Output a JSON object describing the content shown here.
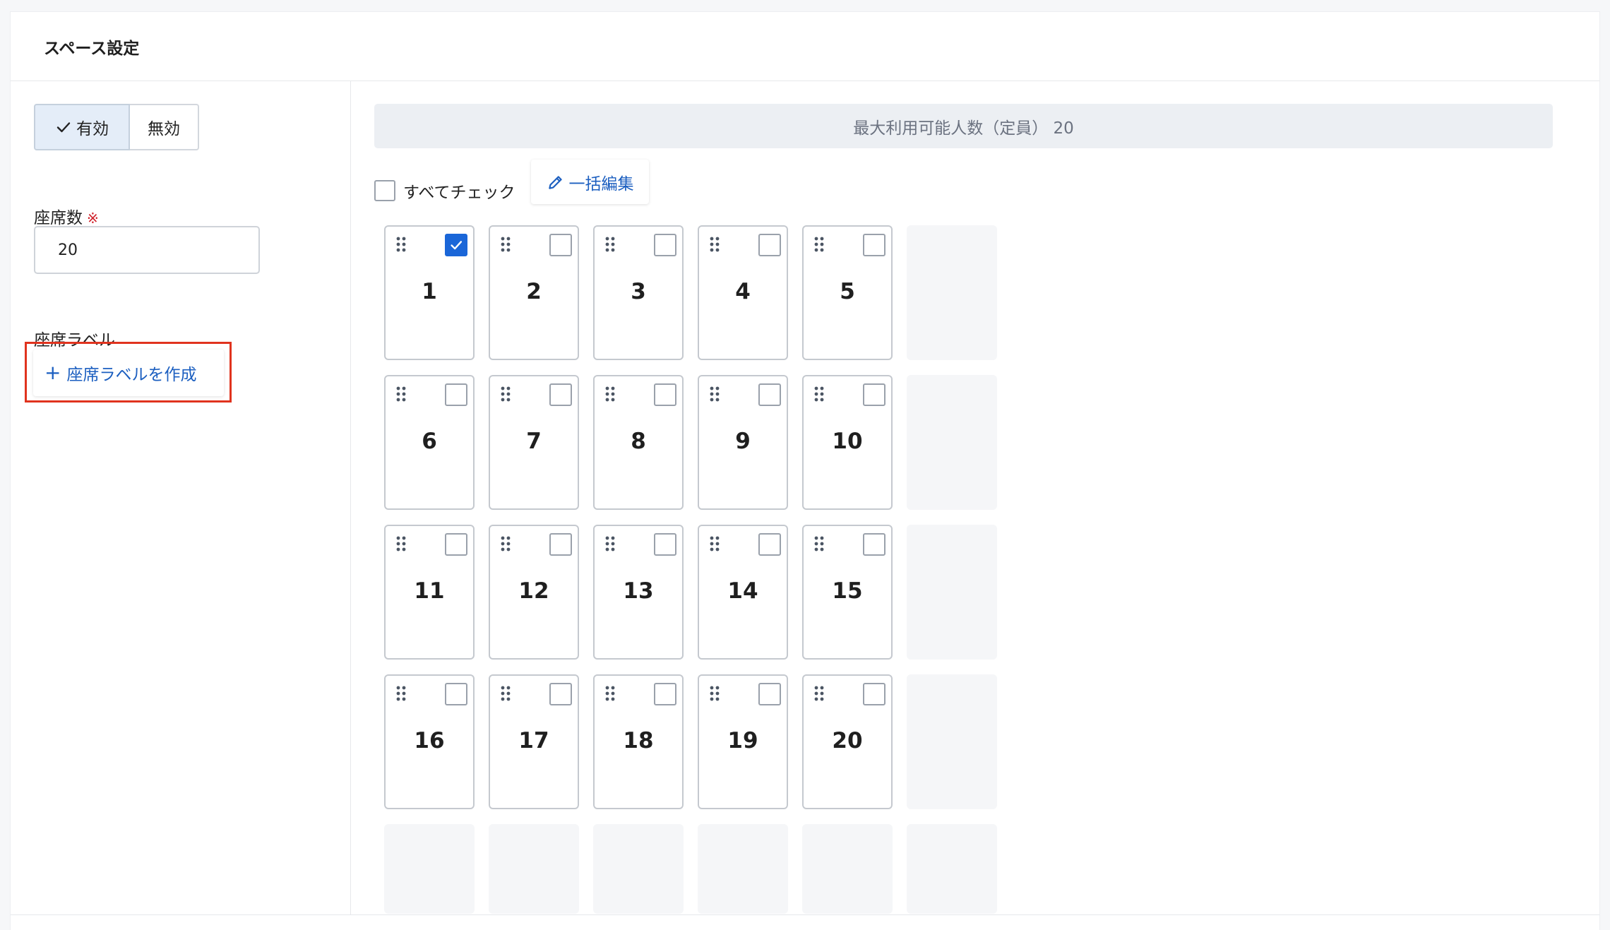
{
  "panel": {
    "title": "スペース設定"
  },
  "sidebar": {
    "toggle_enabled_label": "有効",
    "toggle_disabled_label": "無効",
    "seat_count_label": "座席数",
    "required_mark": "※",
    "seat_count_value": "20",
    "seat_label_heading": "座席ラベル",
    "create_label_button": "座席ラベルを作成",
    "create_label_plus": "+"
  },
  "main": {
    "capacity_text": "最大利用可能人数（定員） 20",
    "check_all_label": "すべてチェック",
    "bulk_edit_label": "一括編集"
  },
  "seats": [
    {
      "label": "1",
      "checked": true
    },
    {
      "label": "2",
      "checked": false
    },
    {
      "label": "3",
      "checked": false
    },
    {
      "label": "4",
      "checked": false
    },
    {
      "label": "5",
      "checked": false
    },
    {
      "label": "6",
      "checked": false
    },
    {
      "label": "7",
      "checked": false
    },
    {
      "label": "8",
      "checked": false
    },
    {
      "label": "9",
      "checked": false
    },
    {
      "label": "10",
      "checked": false
    },
    {
      "label": "11",
      "checked": false
    },
    {
      "label": "12",
      "checked": false
    },
    {
      "label": "13",
      "checked": false
    },
    {
      "label": "14",
      "checked": false
    },
    {
      "label": "15",
      "checked": false
    },
    {
      "label": "16",
      "checked": false
    },
    {
      "label": "17",
      "checked": false
    },
    {
      "label": "18",
      "checked": false
    },
    {
      "label": "19",
      "checked": false
    },
    {
      "label": "20",
      "checked": false
    }
  ],
  "colors": {
    "accent": "#1a66d8",
    "link": "#1c5fc0",
    "highlight_border": "#e0331e"
  },
  "icons": [
    "check-icon",
    "pencil-icon",
    "drag-handle-icon",
    "plus-icon"
  ]
}
